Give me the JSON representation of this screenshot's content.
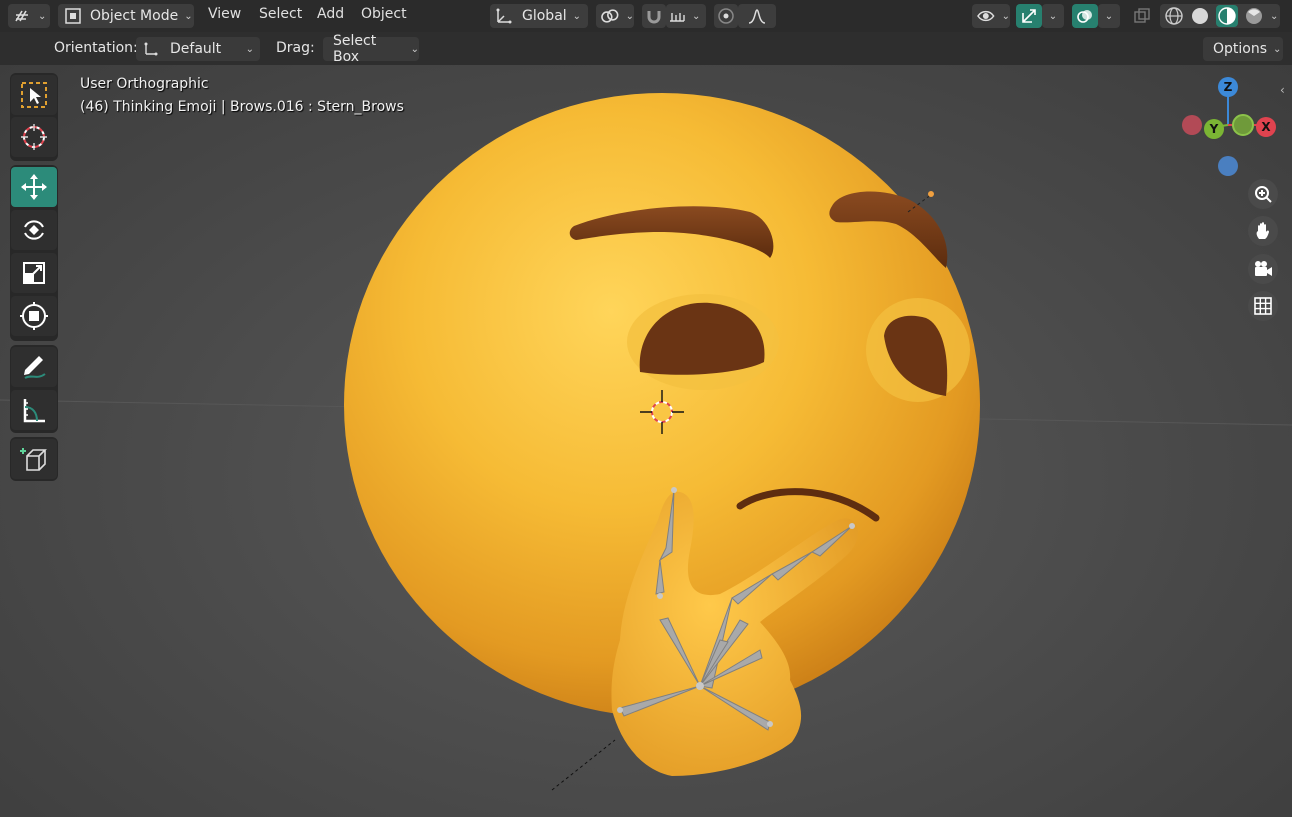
{
  "header": {
    "mode_label": "Object Mode",
    "menus": [
      "View",
      "Select",
      "Add",
      "Object"
    ],
    "transform_orientation": "Global",
    "icons": [
      "editor-type-icon",
      "object-mode-icon",
      "transform-icon",
      "link-icon",
      "magnet-icon",
      "snap-grid-icon",
      "proportional-icon",
      "falloff-icon",
      "visibility-icon",
      "gizmo-icon",
      "overlay-icon",
      "xray-icon",
      "shading-wire-icon",
      "shading-solid-icon",
      "shading-material-icon",
      "shading-rendered-icon"
    ]
  },
  "tool_settings": {
    "orientation_label": "Orientation:",
    "orientation_value": "Default",
    "drag_label": "Drag:",
    "drag_value": "Select Box",
    "options_label": "Options"
  },
  "viewport": {
    "view_name": "User Orthographic",
    "object_info": "(46) Thinking Emoji | Brows.016 : Stern_Brows",
    "gizmo_axes": {
      "z": "Z",
      "y": "Y",
      "x": "X"
    }
  },
  "toolbar": {
    "tools": [
      "select-box",
      "cursor",
      "move",
      "rotate",
      "scale",
      "transform",
      "annotate",
      "measure",
      "add-cube"
    ],
    "active_tool": "move"
  },
  "navigation": [
    "zoom-icon",
    "hand-icon",
    "camera-icon",
    "grid-icon"
  ],
  "colors": {
    "accent": "#2c8b7a",
    "axis_x": "#e0434f",
    "axis_y": "#7bb534",
    "axis_z": "#3c89d8",
    "emoji_face": "#f0b232",
    "brows": "#6a3414"
  }
}
